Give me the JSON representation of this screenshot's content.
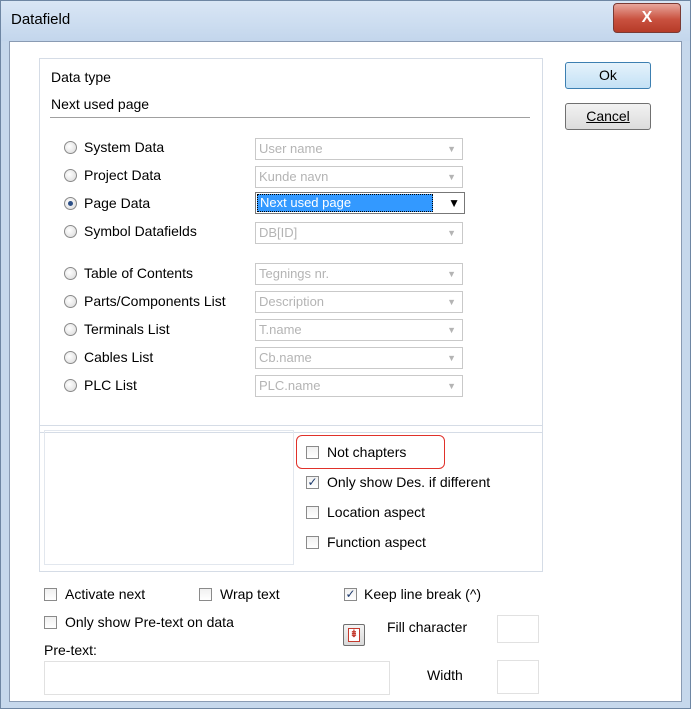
{
  "window": {
    "title": "Datafield",
    "close_glyph": "X"
  },
  "buttons": {
    "ok": "Ok",
    "cancel": "Cancel"
  },
  "data_type": {
    "label": "Data type",
    "value": "Next used page"
  },
  "radios": [
    {
      "label": "System Data",
      "combo": "User name",
      "selected": false
    },
    {
      "label": "Project Data",
      "combo": "Kunde navn",
      "selected": false
    },
    {
      "label": "Page Data",
      "combo": "Next used page",
      "selected": true
    },
    {
      "label": "Symbol Datafields",
      "combo": "DB[ID]",
      "selected": false
    },
    {
      "label": "Table of Contents",
      "combo": "Tegnings nr.",
      "selected": false
    },
    {
      "label": "Parts/Components List",
      "combo": "Description",
      "selected": false
    },
    {
      "label": "Terminals List",
      "combo": "T.name",
      "selected": false
    },
    {
      "label": "Cables List",
      "combo": "Cb.name",
      "selected": false
    },
    {
      "label": "PLC List",
      "combo": "PLC.name",
      "selected": false
    }
  ],
  "options": {
    "not_chapters": {
      "label": "Not chapters",
      "checked": false
    },
    "only_show_des": {
      "label": "Only show Des. if different",
      "checked": true
    },
    "location_aspect": {
      "label": "Location aspect",
      "checked": false
    },
    "function_aspect": {
      "label": "Function aspect",
      "checked": false
    }
  },
  "bottom": {
    "activate_next": {
      "label": "Activate next",
      "checked": false
    },
    "wrap_text": {
      "label": "Wrap text",
      "checked": false
    },
    "keep_line_break": {
      "label": "Keep line break (^)",
      "checked": true
    },
    "only_pretext": {
      "label": "Only show Pre-text on data",
      "checked": false
    },
    "fill_character": "Fill character",
    "pre_text": "Pre-text:",
    "width": "Width"
  },
  "icons": {
    "check_glyph": "✓",
    "arrow_glyph": "▼"
  },
  "colors": {
    "highlight": "#e0312a",
    "selection": "#3399ff"
  }
}
